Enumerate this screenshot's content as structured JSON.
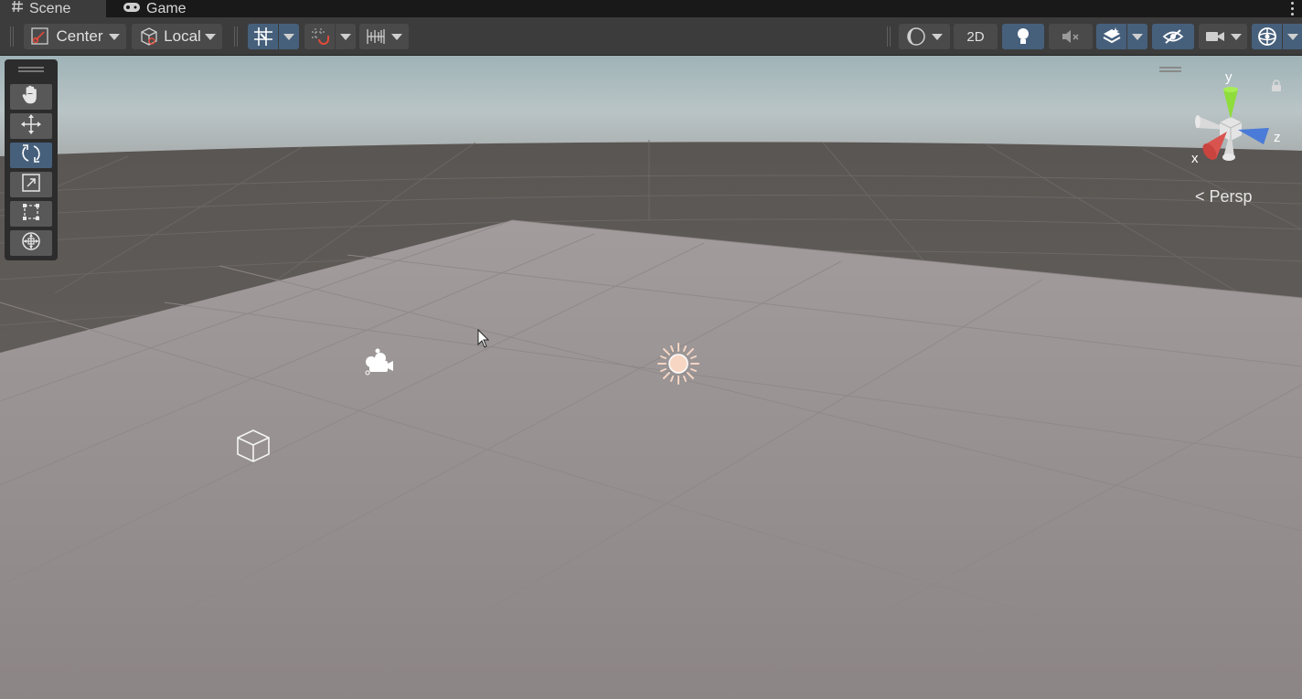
{
  "tabs": [
    {
      "label": "Scene",
      "icon": "grid-hash-icon",
      "active": true
    },
    {
      "label": "Game",
      "icon": "gamepad-icon",
      "active": false
    }
  ],
  "toolbar": {
    "pivot_label": "Center",
    "space_label": "Local",
    "mode_2d_label": "2D"
  },
  "tools": [
    {
      "name": "hand-tool",
      "icon": "hand-icon",
      "active": false
    },
    {
      "name": "move-tool",
      "icon": "move-arrows-icon",
      "active": false
    },
    {
      "name": "rotate-tool",
      "icon": "rotate-icon",
      "active": true
    },
    {
      "name": "scale-tool",
      "icon": "scale-icon",
      "active": false
    },
    {
      "name": "rect-tool",
      "icon": "rect-transform-icon",
      "active": false
    },
    {
      "name": "transform-tool",
      "icon": "transform-icon",
      "active": false
    }
  ],
  "gizmo": {
    "axis_y": "y",
    "axis_x": "x",
    "axis_z": "z",
    "projection_label": "Persp",
    "colors": {
      "x": "#d9534f",
      "y": "#8fdc3d",
      "z": "#4a7bd8"
    }
  },
  "scene_objects": [
    {
      "name": "camera",
      "icon": "camera-gizmo-icon"
    },
    {
      "name": "directional-light",
      "icon": "sun-light-icon"
    },
    {
      "name": "cube",
      "icon": "cube-wireframe-icon"
    }
  ]
}
